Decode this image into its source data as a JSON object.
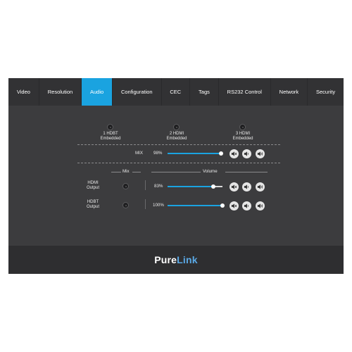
{
  "tabs": [
    {
      "label": "Video",
      "active": false
    },
    {
      "label": "Resolution",
      "active": false
    },
    {
      "label": "Audio",
      "active": true
    },
    {
      "label": "Configuration",
      "active": false
    },
    {
      "label": "CEC",
      "active": false
    },
    {
      "label": "Tags",
      "active": false
    },
    {
      "label": "RS232 Control",
      "active": false
    },
    {
      "label": "Network",
      "active": false
    },
    {
      "label": "Security",
      "active": false
    }
  ],
  "inputs": [
    {
      "line1": "1 HDBT",
      "line2": "Embedded"
    },
    {
      "line1": "2 HDMI",
      "line2": "Embedded"
    },
    {
      "line1": "3 HDMI",
      "line2": "Embedded"
    }
  ],
  "mix_row": {
    "label": "MIX",
    "value_text": "98%",
    "level": 0.98
  },
  "headers": {
    "mix": "Mix",
    "volume": "Volume"
  },
  "outputs": [
    {
      "line1": "HDMI",
      "line2": "Output",
      "value_text": "83%",
      "level": 0.83
    },
    {
      "line1": "HDBT",
      "line2": "Output",
      "value_text": "100%",
      "level": 1.0
    }
  ],
  "icons": [
    "mute-icon",
    "volume-down-icon",
    "volume-up-icon"
  ],
  "colors": {
    "accent": "#1aa3e0",
    "panel": "#3c3c3e",
    "tabbar": "#323234"
  },
  "logo": {
    "part1": "Pure",
    "part2": "Link"
  }
}
